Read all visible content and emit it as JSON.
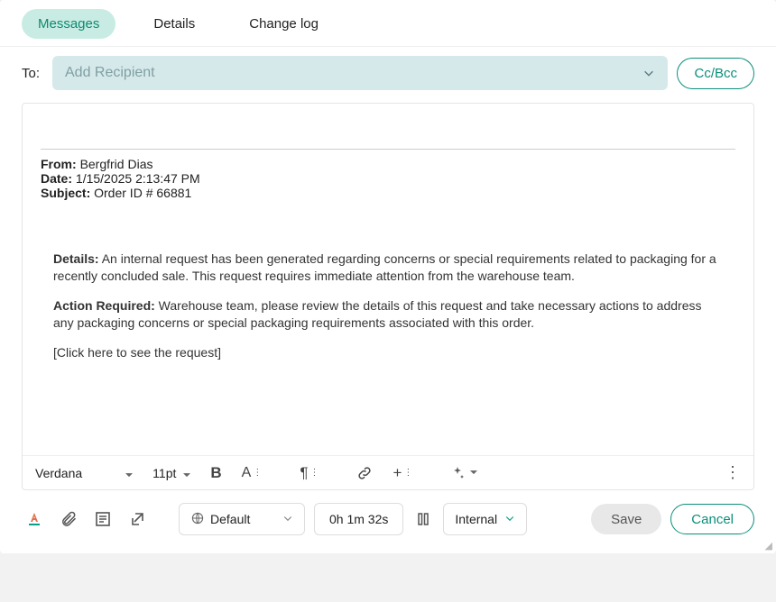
{
  "tabs": {
    "messages": "Messages",
    "details": "Details",
    "changelog": "Change log"
  },
  "recipient": {
    "to_label": "To:",
    "placeholder": "Add Recipient",
    "ccbcc": "Cc/Bcc"
  },
  "email": {
    "from_label": "From:",
    "from_value": "Bergfrid Dias",
    "date_label": "Date:",
    "date_value": "1/15/2025 2:13:47 PM",
    "subject_label": "Subject:",
    "subject_value": "Order ID # 66881",
    "details_label": "Details:",
    "details_text": "An internal request has been generated regarding concerns or special requirements related to packaging for a recently concluded sale. This request requires immediate attention from the warehouse team.",
    "action_label": "Action Required:",
    "action_text": "Warehouse team, please review the details of this request and take necessary actions to address any packaging concerns or special packaging requirements associated with this order.",
    "link_text": "[Click here to see the request]"
  },
  "toolbar": {
    "font_family": "Verdana",
    "font_size": "11pt"
  },
  "footer": {
    "language": "Default",
    "timer": "0h 1m 32s",
    "visibility": "Internal",
    "save": "Save",
    "cancel": "Cancel"
  }
}
